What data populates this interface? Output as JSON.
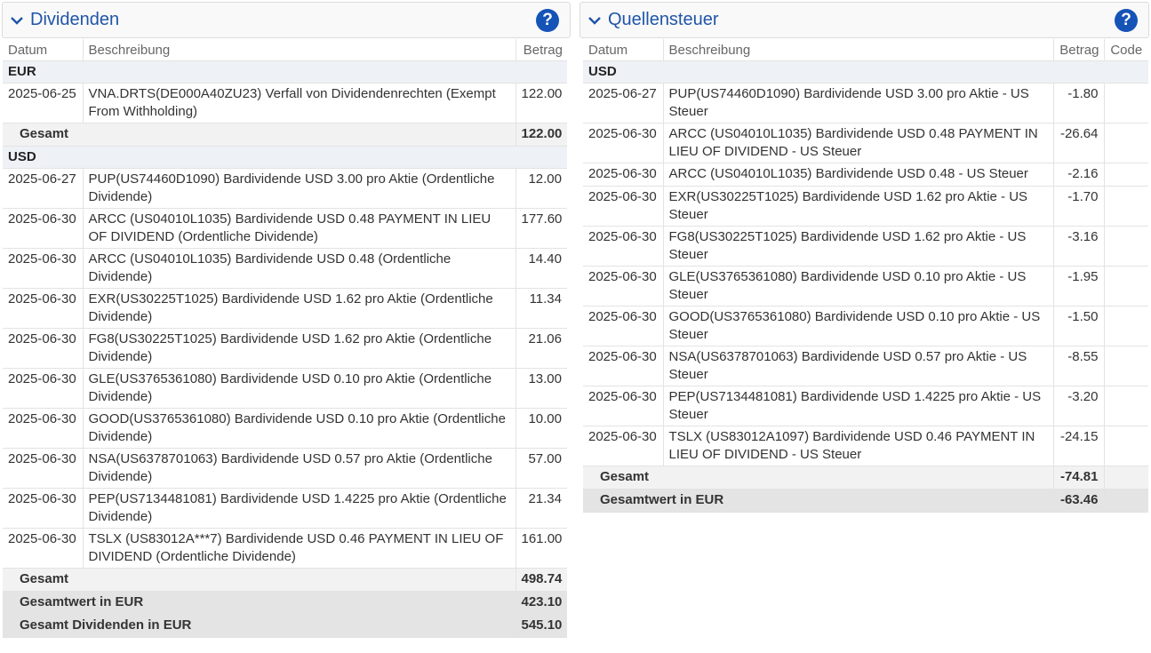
{
  "dividends": {
    "title": "Dividenden",
    "help": "?",
    "columns": {
      "date": "Datum",
      "desc": "Beschreibung",
      "amount": "Betrag"
    },
    "groups": [
      {
        "currency": "EUR",
        "rows": [
          {
            "date": "2025-06-25",
            "desc": "VNA.DRTS(DE000A40ZU23) Verfall von Dividendenrechten (Exempt From Withholding)",
            "amount": "122.00"
          }
        ],
        "total_label": "Gesamt",
        "total": "122.00"
      },
      {
        "currency": "USD",
        "rows": [
          {
            "date": "2025-06-27",
            "desc": "PUP(US74460D1090) Bardividende USD 3.00 pro Aktie (Ordentliche Dividende)",
            "amount": "12.00"
          },
          {
            "date": "2025-06-30",
            "desc": "ARCC (US04010L1035) Bardividende USD 0.48 PAYMENT IN LIEU OF DIVIDEND (Ordentliche Dividende)",
            "amount": "177.60"
          },
          {
            "date": "2025-06-30",
            "desc": "ARCC (US04010L1035) Bardividende USD 0.48 (Ordentliche Dividende)",
            "amount": "14.40"
          },
          {
            "date": "2025-06-30",
            "desc": "EXR(US30225T1025) Bardividende USD 1.62 pro Aktie (Ordentliche Dividende)",
            "amount": "11.34"
          },
          {
            "date": "2025-06-30",
            "desc": "FG8(US30225T1025) Bardividende USD 1.62 pro Aktie (Ordentliche Dividende)",
            "amount": "21.06"
          },
          {
            "date": "2025-06-30",
            "desc": "GLE(US3765361080) Bardividende USD 0.10 pro Aktie (Ordentliche Dividende)",
            "amount": "13.00"
          },
          {
            "date": "2025-06-30",
            "desc": "GOOD(US3765361080) Bardividende USD 0.10 pro Aktie (Ordentliche Dividende)",
            "amount": "10.00"
          },
          {
            "date": "2025-06-30",
            "desc": "NSA(US6378701063) Bardividende USD 0.57 pro Aktie (Ordentliche Dividende)",
            "amount": "57.00"
          },
          {
            "date": "2025-06-30",
            "desc": "PEP(US7134481081) Bardividende USD 1.4225 pro Aktie (Ordentliche Dividende)",
            "amount": "21.34"
          },
          {
            "date": "2025-06-30",
            "desc": "TSLX (US83012A***7) Bardividende USD 0.46 PAYMENT IN LIEU OF DIVIDEND (Ordentliche Dividende)",
            "amount": "161.00"
          }
        ],
        "total_label": "Gesamt",
        "total": "498.74",
        "eur_label": "Gesamtwert in EUR",
        "eur_total": "423.10"
      }
    ],
    "grand_label": "Gesamt Dividenden in EUR",
    "grand_total": "545.10"
  },
  "withholding": {
    "title": "Quellensteuer",
    "help": "?",
    "columns": {
      "date": "Datum",
      "desc": "Beschreibung",
      "amount": "Betrag",
      "code": "Code"
    },
    "currency": "USD",
    "rows": [
      {
        "date": "2025-06-27",
        "desc": "PUP(US74460D1090) Bardividende USD 3.00 pro Aktie - US Steuer",
        "amount": "-1.80",
        "code": ""
      },
      {
        "date": "2025-06-30",
        "desc": "ARCC (US04010L1035) Bardividende USD 0.48 PAYMENT IN LIEU OF DIVIDEND - US Steuer",
        "amount": "-26.64",
        "code": ""
      },
      {
        "date": "2025-06-30",
        "desc": "ARCC (US04010L1035) Bardividende USD 0.48 - US Steuer",
        "amount": "-2.16",
        "code": ""
      },
      {
        "date": "2025-06-30",
        "desc": "EXR(US30225T1025) Bardividende USD 1.62 pro Aktie - US Steuer",
        "amount": "-1.70",
        "code": ""
      },
      {
        "date": "2025-06-30",
        "desc": "FG8(US30225T1025) Bardividende USD 1.62 pro Aktie - US Steuer",
        "amount": "-3.16",
        "code": ""
      },
      {
        "date": "2025-06-30",
        "desc": "GLE(US3765361080) Bardividende USD 0.10 pro Aktie - US Steuer",
        "amount": "-1.95",
        "code": ""
      },
      {
        "date": "2025-06-30",
        "desc": "GOOD(US3765361080) Bardividende USD 0.10 pro Aktie - US Steuer",
        "amount": "-1.50",
        "code": ""
      },
      {
        "date": "2025-06-30",
        "desc": "NSA(US6378701063) Bardividende USD 0.57 pro Aktie - US Steuer",
        "amount": "-8.55",
        "code": ""
      },
      {
        "date": "2025-06-30",
        "desc": "PEP(US7134481081) Bardividende USD 1.4225 pro Aktie - US Steuer",
        "amount": "-3.20",
        "code": ""
      },
      {
        "date": "2025-06-30",
        "desc": "TSLX (US83012A1097) Bardividende USD 0.46 PAYMENT IN LIEU OF DIVIDEND - US Steuer",
        "amount": "-24.15",
        "code": ""
      }
    ],
    "total_label": "Gesamt",
    "total": "-74.81",
    "eur_label": "Gesamtwert in EUR",
    "eur_total": "-63.46"
  }
}
